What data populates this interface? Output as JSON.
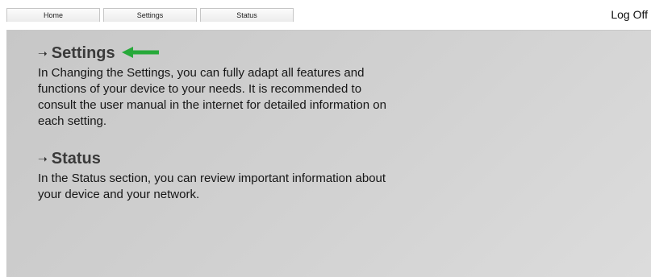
{
  "tabs": [
    {
      "label": "Home"
    },
    {
      "label": "Settings"
    },
    {
      "label": "Status"
    }
  ],
  "header": {
    "logoff_label": "Log Off"
  },
  "sections": [
    {
      "title": "Settings",
      "description": "In Changing the Settings, you can fully adapt all features and functions of your device to your needs. It is recommended to consult the user manual in the internet for detailed information on each setting."
    },
    {
      "title": "Status",
      "description": "In the Status section, you can review important information about your device and your network."
    }
  ],
  "icons": {
    "heading_arrow": "right-arrow-icon",
    "highlight_arrow": "green-left-arrow-icon"
  },
  "colors": {
    "panel_background": "#d0d0d0",
    "highlight_arrow": "#27a93a",
    "heading_text": "#3a3a3a"
  }
}
